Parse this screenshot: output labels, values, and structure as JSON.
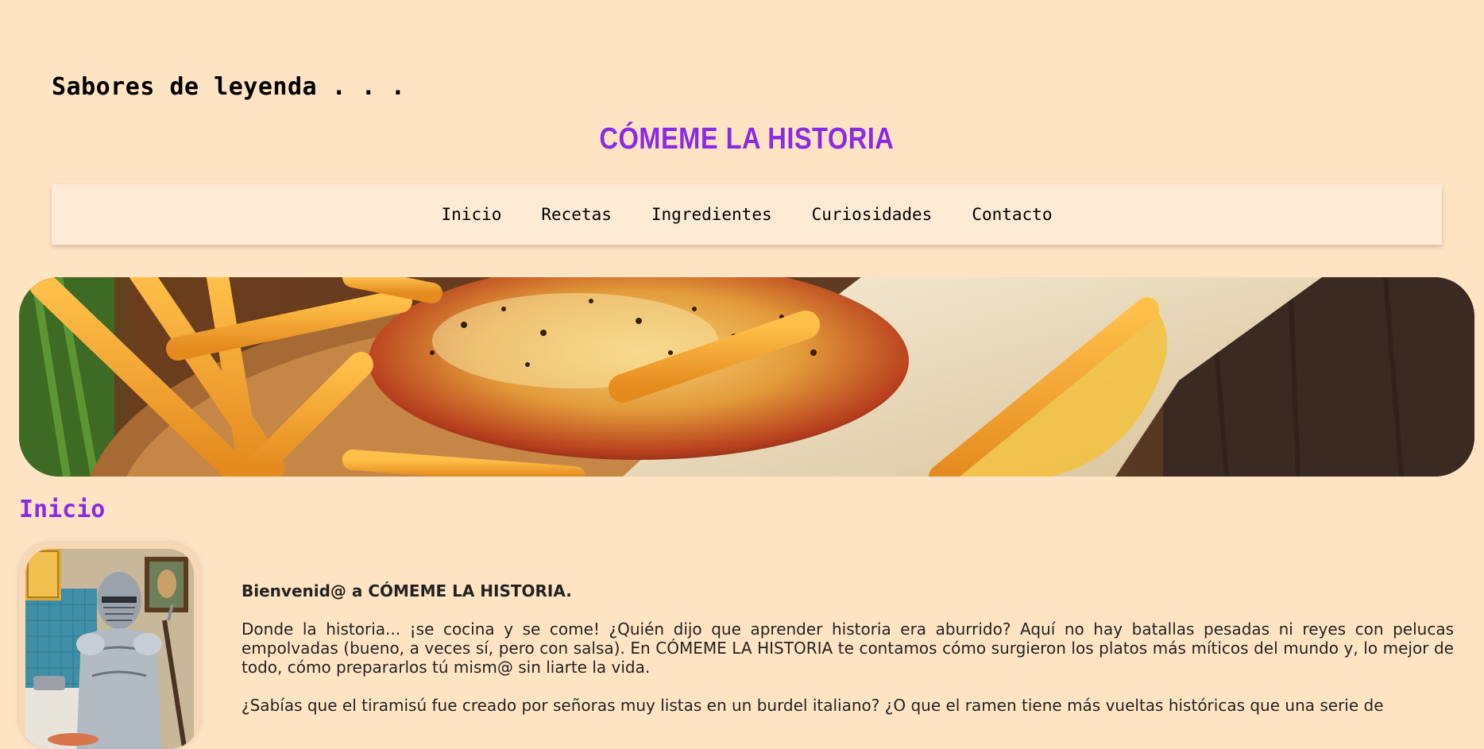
{
  "header": {
    "tagline": "Sabores de leyenda . . .",
    "brand": "CÓMEME LA HISTORIA"
  },
  "nav": {
    "items": [
      {
        "label": "Inicio"
      },
      {
        "label": "Recetas"
      },
      {
        "label": "Ingredientes"
      },
      {
        "label": "Curiosidades"
      },
      {
        "label": "Contacto"
      }
    ]
  },
  "hero": {
    "alt": "Cesta con patatas fritas, pan y pollo asado"
  },
  "main": {
    "section_title": "Inicio",
    "portrait_alt": "Caballero con armadura cocinando",
    "welcome": "Bienvenid@ a CÓMEME LA HISTORIA.",
    "paragraph_1": "Donde la historia... ¡se cocina y se come! ¿Quién dijo que aprender historia era aburrido? Aquí no hay batallas pesadas ni reyes con pelucas empolvadas (bueno, a veces sí, pero con salsa). En CÓMEME LA HISTORIA te contamos cómo surgieron los platos más míticos del mundo y, lo mejor de todo, cómo prepararlos tú mism@ sin liarte la vida.",
    "paragraph_2": "¿Sabías que el tiramisú fue creado por señoras muy listas en un burdel italiano? ¿O que el ramen tiene más vueltas históricas que una serie de"
  },
  "colors": {
    "background": "#ffe4c4",
    "accent": "#8a2be2",
    "nav_background": "#fdebd6"
  }
}
